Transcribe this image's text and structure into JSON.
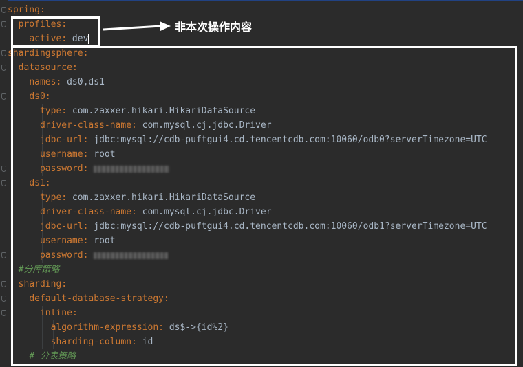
{
  "annotation": {
    "text": "非本次操作内容"
  },
  "code_lines": [
    {
      "indent": "",
      "key": "spring",
      "colon": ":",
      "value": ""
    },
    {
      "indent": "  ",
      "key": "profiles",
      "colon": ":",
      "value": ""
    },
    {
      "indent": "    ",
      "key": "active",
      "colon": ":",
      "value": " dev"
    },
    {
      "indent": "",
      "key": "shardingsphere",
      "colon": ":",
      "value": ""
    },
    {
      "indent": "  ",
      "key": "datasource",
      "colon": ":",
      "value": ""
    },
    {
      "indent": "    ",
      "key": "names",
      "colon": ":",
      "value": " ds0,ds1"
    },
    {
      "indent": "    ",
      "key": "ds0",
      "colon": ":",
      "value": ""
    },
    {
      "indent": "      ",
      "key": "type",
      "colon": ":",
      "value": " com.zaxxer.hikari.HikariDataSource"
    },
    {
      "indent": "      ",
      "key": "driver-class-name",
      "colon": ":",
      "value": " com.mysql.cj.jdbc.Driver"
    },
    {
      "indent": "      ",
      "key": "jdbc-url",
      "colon": ":",
      "value": " jdbc:mysql://cdb-puftgui4.cd.tencentcdb.com:10060/odb0?serverTimezone=UTC"
    },
    {
      "indent": "      ",
      "key": "username",
      "colon": ":",
      "value": " root"
    },
    {
      "indent": "      ",
      "key": "password",
      "colon": ":",
      "value": ""
    },
    {
      "indent": "    ",
      "key": "ds1",
      "colon": ":",
      "value": ""
    },
    {
      "indent": "      ",
      "key": "type",
      "colon": ":",
      "value": " com.zaxxer.hikari.HikariDataSource"
    },
    {
      "indent": "      ",
      "key": "driver-class-name",
      "colon": ":",
      "value": " com.mysql.cj.jdbc.Driver"
    },
    {
      "indent": "      ",
      "key": "jdbc-url",
      "colon": ":",
      "value": " jdbc:mysql://cdb-puftgui4.cd.tencentcdb.com:10060/odb1?serverTimezone=UTC"
    },
    {
      "indent": "      ",
      "key": "username",
      "colon": ":",
      "value": " root"
    },
    {
      "indent": "      ",
      "key": "password",
      "colon": ":",
      "value": ""
    },
    {
      "indent": "  ",
      "comment": "#分库策略"
    },
    {
      "indent": "  ",
      "key": "sharding",
      "colon": ":",
      "value": ""
    },
    {
      "indent": "    ",
      "key": "default-database-strategy",
      "colon": ":",
      "value": ""
    },
    {
      "indent": "      ",
      "key": "inline",
      "colon": ":",
      "value": ""
    },
    {
      "indent": "        ",
      "key": "algorithm-expression",
      "colon": ":",
      "value": " ds$->{id%2}"
    },
    {
      "indent": "        ",
      "key": "sharding-column",
      "colon": ":",
      "value": " id"
    },
    {
      "indent": "    ",
      "comment": "# 分表策略"
    }
  ]
}
